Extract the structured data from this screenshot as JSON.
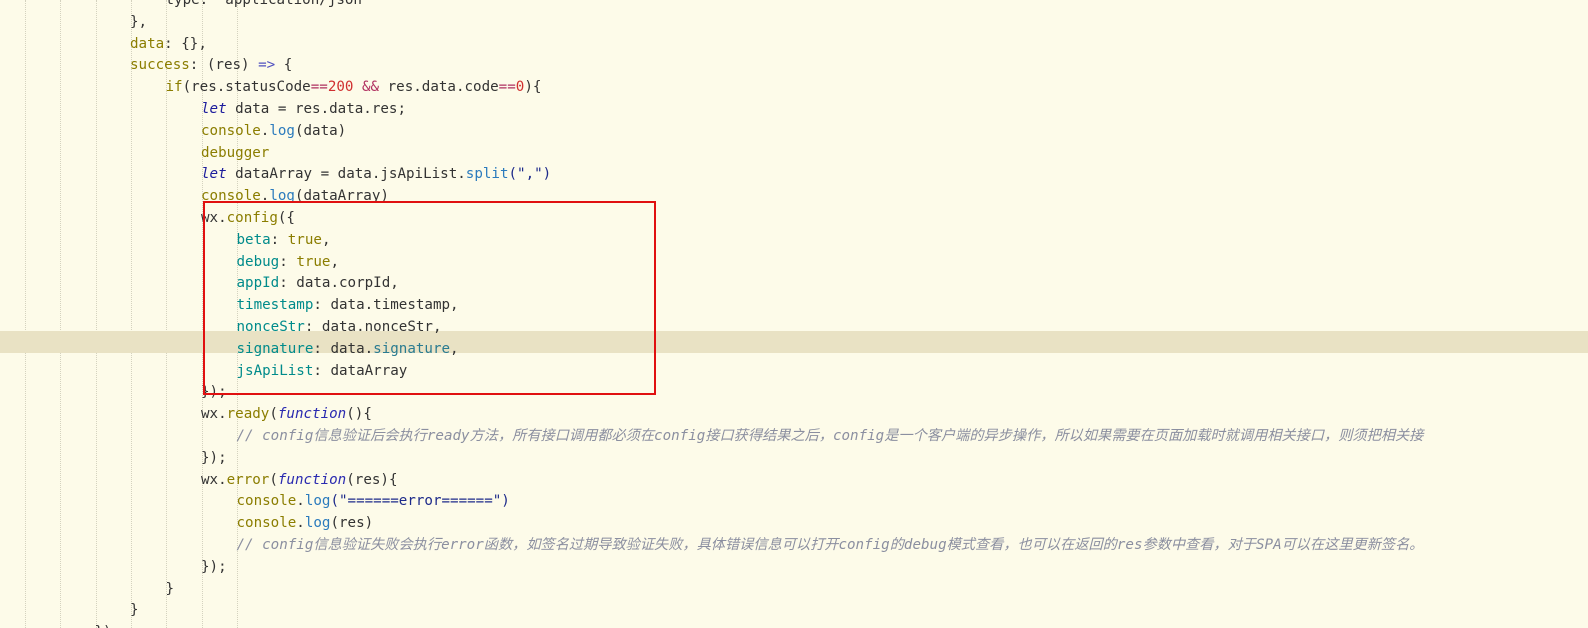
{
  "editor": {
    "language": "javascript",
    "highlighted_line": 16,
    "selection_box_color": "#e01010"
  },
  "lines": [
    {
      "indent": 5,
      "tokens": [
        {
          "t": "type: 'application/json'",
          "c": "plain"
        }
      ]
    },
    {
      "indent": 4,
      "tokens": [
        {
          "t": "},",
          "c": "plain"
        }
      ]
    },
    {
      "indent": 4,
      "tokens": [
        {
          "t": "data",
          "c": "kw"
        },
        {
          "t": ": {},",
          "c": "plain"
        }
      ]
    },
    {
      "indent": 4,
      "tokens": [
        {
          "t": "success",
          "c": "kw"
        },
        {
          "t": ": (res) ",
          "c": "plain"
        },
        {
          "t": "=>",
          "c": "arrow"
        },
        {
          "t": " {",
          "c": "plain"
        }
      ]
    },
    {
      "indent": 5,
      "tokens": [
        {
          "t": "if",
          "c": "kw"
        },
        {
          "t": "(res.statusCode",
          "c": "plain"
        },
        {
          "t": "==",
          "c": "op"
        },
        {
          "t": "200",
          "c": "num"
        },
        {
          "t": " ",
          "c": "plain"
        },
        {
          "t": "&&",
          "c": "op"
        },
        {
          "t": " res.data.code",
          "c": "plain"
        },
        {
          "t": "==",
          "c": "op"
        },
        {
          "t": "0",
          "c": "num"
        },
        {
          "t": "){",
          "c": "plain"
        }
      ]
    },
    {
      "indent": 6,
      "tokens": [
        {
          "t": "let",
          "c": "let"
        },
        {
          "t": " data = res.data.res;",
          "c": "plain"
        }
      ]
    },
    {
      "indent": 6,
      "tokens": [
        {
          "t": "console",
          "c": "kw"
        },
        {
          "t": ".",
          "c": "plain"
        },
        {
          "t": "log",
          "c": "call"
        },
        {
          "t": "(data)",
          "c": "plain"
        }
      ]
    },
    {
      "indent": 6,
      "tokens": [
        {
          "t": "debugger",
          "c": "debug"
        }
      ]
    },
    {
      "indent": 6,
      "tokens": [
        {
          "t": "let",
          "c": "let"
        },
        {
          "t": " dataArray = data.jsApiList.",
          "c": "plain"
        },
        {
          "t": "split",
          "c": "call"
        },
        {
          "t": "(\",\")",
          "c": "str"
        }
      ]
    },
    {
      "indent": 6,
      "tokens": [
        {
          "t": "console",
          "c": "kw"
        },
        {
          "t": ".",
          "c": "plain"
        },
        {
          "t": "log",
          "c": "call"
        },
        {
          "t": "(dataArray)",
          "c": "plain"
        }
      ]
    },
    {
      "indent": 6,
      "tokens": [
        {
          "t": "wx.",
          "c": "plain"
        },
        {
          "t": "config",
          "c": "fn"
        },
        {
          "t": "({",
          "c": "plain"
        }
      ]
    },
    {
      "indent": 7,
      "tokens": [
        {
          "t": "beta",
          "c": "prop"
        },
        {
          "t": ": ",
          "c": "plain"
        },
        {
          "t": "true",
          "c": "bool"
        },
        {
          "t": ",",
          "c": "plain"
        }
      ]
    },
    {
      "indent": 7,
      "tokens": [
        {
          "t": "debug",
          "c": "prop"
        },
        {
          "t": ": ",
          "c": "plain"
        },
        {
          "t": "true",
          "c": "bool"
        },
        {
          "t": ",",
          "c": "plain"
        }
      ]
    },
    {
      "indent": 7,
      "tokens": [
        {
          "t": "appId",
          "c": "prop"
        },
        {
          "t": ": data.corpId,",
          "c": "plain"
        }
      ]
    },
    {
      "indent": 7,
      "tokens": [
        {
          "t": "timestamp",
          "c": "prop"
        },
        {
          "t": ": data.timestamp,",
          "c": "plain"
        }
      ]
    },
    {
      "indent": 7,
      "tokens": [
        {
          "t": "nonceStr",
          "c": "prop"
        },
        {
          "t": ": data.nonceStr,",
          "c": "plain"
        }
      ]
    },
    {
      "indent": 7,
      "tokens": [
        {
          "t": "signature",
          "c": "prop"
        },
        {
          "t": ": data.",
          "c": "plain"
        },
        {
          "t": "signature",
          "c": "prop2"
        },
        {
          "t": ",",
          "c": "plain"
        }
      ]
    },
    {
      "indent": 7,
      "tokens": [
        {
          "t": "jsApiList",
          "c": "prop"
        },
        {
          "t": ": dataArray",
          "c": "plain"
        }
      ]
    },
    {
      "indent": 6,
      "tokens": [
        {
          "t": "});",
          "c": "plain"
        }
      ]
    },
    {
      "indent": 6,
      "tokens": [
        {
          "t": "wx.",
          "c": "plain"
        },
        {
          "t": "ready",
          "c": "fn"
        },
        {
          "t": "(",
          "c": "plain"
        },
        {
          "t": "function",
          "c": "func"
        },
        {
          "t": "(){",
          "c": "plain"
        }
      ]
    },
    {
      "indent": 7,
      "tokens": [
        {
          "t": "// config信息验证后会执行ready方法，所有接口调用都必须在config接口获得结果之后，config是一个客户端的异步操作，所以如果需要在页面加载时就调用相关接口，则须把相关接",
          "c": "cmt"
        }
      ]
    },
    {
      "indent": 6,
      "tokens": [
        {
          "t": "});",
          "c": "plain"
        }
      ]
    },
    {
      "indent": 6,
      "tokens": [
        {
          "t": "wx.",
          "c": "plain"
        },
        {
          "t": "error",
          "c": "fn"
        },
        {
          "t": "(",
          "c": "plain"
        },
        {
          "t": "function",
          "c": "func"
        },
        {
          "t": "(res){",
          "c": "plain"
        }
      ]
    },
    {
      "indent": 7,
      "tokens": [
        {
          "t": "console",
          "c": "kw"
        },
        {
          "t": ".",
          "c": "plain"
        },
        {
          "t": "log",
          "c": "call"
        },
        {
          "t": "(\"======error======\")",
          "c": "str"
        }
      ]
    },
    {
      "indent": 7,
      "tokens": [
        {
          "t": "console",
          "c": "kw"
        },
        {
          "t": ".",
          "c": "plain"
        },
        {
          "t": "log",
          "c": "call"
        },
        {
          "t": "(res)",
          "c": "plain"
        }
      ]
    },
    {
      "indent": 7,
      "tokens": [
        {
          "t": "// config信息验证失败会执行error函数，如签名过期导致验证失败，具体错误信息可以打开config的debug模式查看，也可以在返回的res参数中查看，对于SPA可以在这里更新签名。",
          "c": "cmt"
        }
      ]
    },
    {
      "indent": 6,
      "tokens": [
        {
          "t": "});",
          "c": "plain"
        }
      ]
    },
    {
      "indent": 5,
      "tokens": [
        {
          "t": "}",
          "c": "plain"
        }
      ]
    },
    {
      "indent": 4,
      "tokens": [
        {
          "t": "}",
          "c": "plain"
        }
      ]
    },
    {
      "indent": 3,
      "tokens": [
        {
          "t": "})",
          "c": "plain"
        }
      ]
    }
  ]
}
